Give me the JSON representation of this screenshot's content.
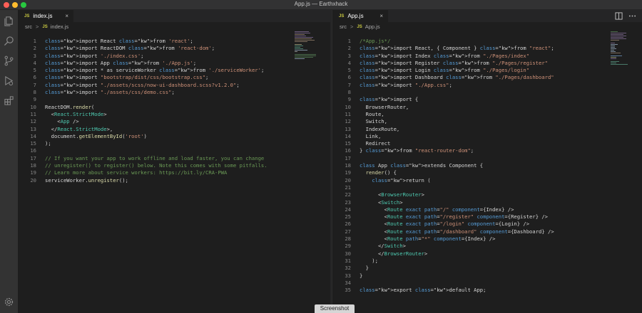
{
  "window": {
    "title": "App.js — Earthxhack"
  },
  "icons": {
    "explorer": "files-icon",
    "search": "search-icon",
    "scm": "source-control-icon",
    "debug": "run-debug-icon",
    "extensions": "extensions-icon",
    "settings": "gear-icon"
  },
  "left_editor": {
    "tab": {
      "badge": "JS",
      "label": "index.js",
      "close": "×"
    },
    "breadcrumb": {
      "folder": "src",
      "sep": ">",
      "badge": "JS",
      "file": "index.js"
    },
    "lines": [
      {
        "n": "1",
        "text": "import React from 'react';"
      },
      {
        "n": "2",
        "text": "import ReactDOM from 'react-dom';"
      },
      {
        "n": "3",
        "text": "import './index.css';"
      },
      {
        "n": "4",
        "text": "import App from './App.js';"
      },
      {
        "n": "5",
        "text": "import * as serviceWorker from './serviceWorker';"
      },
      {
        "n": "6",
        "text": "import \"bootstrap/dist/css/bootstrap.css\";"
      },
      {
        "n": "7",
        "text": "import \"./assets/scss/now-ui-dashboard.scss?v1.2.0\";"
      },
      {
        "n": "8",
        "text": "import \"./assets/css/demo.css\";"
      },
      {
        "n": "9",
        "text": ""
      },
      {
        "n": "10",
        "text": "ReactDOM.render("
      },
      {
        "n": "11",
        "text": "  <React.StrictMode>"
      },
      {
        "n": "12",
        "text": "    <App />"
      },
      {
        "n": "13",
        "text": "  </React.StrictMode>,"
      },
      {
        "n": "14",
        "text": "  document.getElementById('root')"
      },
      {
        "n": "15",
        "text": ");"
      },
      {
        "n": "16",
        "text": ""
      },
      {
        "n": "17",
        "text": "// If you want your app to work offline and load faster, you can change"
      },
      {
        "n": "18",
        "text": "// unregister() to register() below. Note this comes with some pitfalls."
      },
      {
        "n": "19",
        "text": "// Learn more about service workers: https://bit.ly/CRA-PWA"
      },
      {
        "n": "20",
        "text": "serviceWorker.unregister();"
      }
    ]
  },
  "right_editor": {
    "tab": {
      "badge": "JS",
      "label": "App.js",
      "close": "×"
    },
    "breadcrumb": {
      "folder": "src",
      "sep": ">",
      "badge": "JS",
      "file": "App.js"
    },
    "lines": [
      {
        "n": "1",
        "text": "/*App.js*/"
      },
      {
        "n": "2",
        "text": "import React, { Component } from \"react\";"
      },
      {
        "n": "3",
        "text": "import Index from \"./Pages/index\""
      },
      {
        "n": "4",
        "text": "import Register from \"./Pages/register\""
      },
      {
        "n": "5",
        "text": "import Login from \"./Pages/login\""
      },
      {
        "n": "6",
        "text": "import Dashboard from \"./Pages/dashboard\""
      },
      {
        "n": "7",
        "text": "import \"./App.css\";"
      },
      {
        "n": "8",
        "text": ""
      },
      {
        "n": "9",
        "text": "import {"
      },
      {
        "n": "10",
        "text": "  BrowserRouter,"
      },
      {
        "n": "11",
        "text": "  Route,"
      },
      {
        "n": "12",
        "text": "  Switch,"
      },
      {
        "n": "13",
        "text": "  IndexRoute,"
      },
      {
        "n": "14",
        "text": "  Link,"
      },
      {
        "n": "15",
        "text": "  Redirect"
      },
      {
        "n": "16",
        "text": "} from \"react-router-dom\";"
      },
      {
        "n": "17",
        "text": ""
      },
      {
        "n": "18",
        "text": "class App extends Component {"
      },
      {
        "n": "19",
        "text": "  render() {"
      },
      {
        "n": "20",
        "text": "    return ("
      },
      {
        "n": "21",
        "text": ""
      },
      {
        "n": "22",
        "text": "      <BrowserRouter>"
      },
      {
        "n": "23",
        "text": "      <Switch>"
      },
      {
        "n": "24",
        "text": "        <Route exact path=\"/\" component={Index} />"
      },
      {
        "n": "25",
        "text": "        <Route exact path=\"/register\" component={Register} />"
      },
      {
        "n": "26",
        "text": "        <Route exact path=\"/login\" component={Login} />"
      },
      {
        "n": "27",
        "text": "        <Route exact path=\"/dashboard\" component={Dashboard} />"
      },
      {
        "n": "28",
        "text": "        <Route path=\"*\" component={Index} />"
      },
      {
        "n": "29",
        "text": "      </Switch>"
      },
      {
        "n": "30",
        "text": "      </BrowserRouter>"
      },
      {
        "n": "31",
        "text": "    );"
      },
      {
        "n": "32",
        "text": "  }"
      },
      {
        "n": "33",
        "text": "}"
      },
      {
        "n": "34",
        "text": ""
      },
      {
        "n": "35",
        "text": "export default App;"
      }
    ]
  },
  "tooltip": {
    "label": "Screenshot"
  }
}
